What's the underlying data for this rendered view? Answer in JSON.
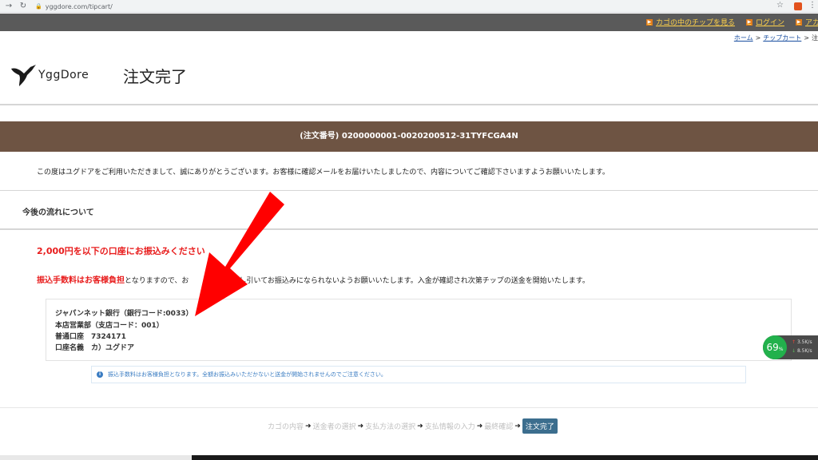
{
  "browser": {
    "back_icon": "arrow-left-icon",
    "reload_icon": "reload-icon",
    "url": "yggdore.com/tipcart/"
  },
  "topbar": {
    "links": [
      {
        "label": "カゴの中のチップを見る"
      },
      {
        "label": "ログイン"
      },
      {
        "label": "アカウン"
      }
    ]
  },
  "breadcrumb": {
    "home": "ホーム",
    "cart": "チップカート",
    "sep": ">",
    "current": "注"
  },
  "header": {
    "logo_text": "YggDore",
    "title": "注文完了"
  },
  "order": {
    "number_text": "(注文番号) 0200000001-0020200512-31TYFCGA4N"
  },
  "thanks_text": "この度はユグドアをご利用いただきまして、誠にありがとうございます。お客様に確認メールをお届けいたしましたので、内容についてご確認下さいますようお願いいたします。",
  "flow_title": "今後の流れについて",
  "transfer": {
    "heading": "2,000円を以下の口座にお振込みください",
    "fee_emphasis": "振込手数料はお客様負担",
    "fee_text_a": "となりますので、お",
    "fee_text_b": "から差し引いてお振込みになられないようお願いいたします。入金が確認され次第チップの送金を開始いたします。"
  },
  "bank": {
    "line1": "ジャパンネット銀行（銀行コード:0033）",
    "line2": "本店営業部（支店コード：001）",
    "line3": "普通口座　7324171",
    "line4": "口座名義　カ）ユグドア"
  },
  "notice_text": "振込手数料はお客様負担となります。全額お振込みいただかないと送金が開始されませんのでご注意ください。",
  "steps": {
    "items": [
      "カゴの内容",
      "送金者の選択",
      "支払方法の選択",
      "支払情報の入力",
      "最終確認"
    ],
    "current": "注文完了"
  },
  "network": {
    "percent": "69",
    "percent_unit": "%",
    "up": "3.5K/s",
    "down": "8.5K/s"
  },
  "colors": {
    "topbar": "#5a5a5a",
    "order_bar": "#6e5443",
    "alert_red": "#e81c1c",
    "current_step": "#3c6e8e",
    "annotation_arrow": "#ff0000"
  }
}
